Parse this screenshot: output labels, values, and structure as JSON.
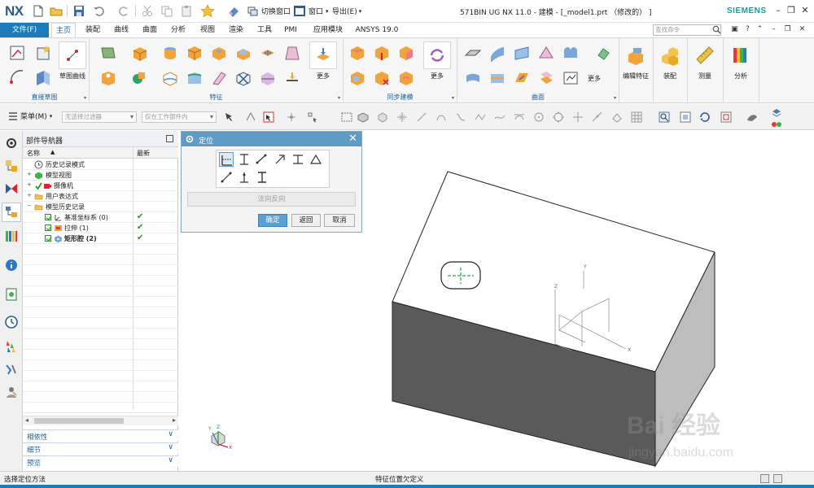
{
  "app": {
    "logo": "NX",
    "window_title": "571BIN UG NX 11.0 - 建模 - [_model1.prt （修改的） ]",
    "vendor": "SIEMENS",
    "switch_window": "切换窗口",
    "window_menu": "窗口",
    "export_menu": "导出(E)",
    "accent_color": "#1c7bb8"
  },
  "ribbon_tabs": {
    "file": "文件(F)",
    "items": [
      "主页",
      "装配",
      "曲线",
      "曲面",
      "分析",
      "视图",
      "渲染",
      "工具",
      "PMI",
      "应用模块",
      "ANSYS 19.0"
    ],
    "active": "主页",
    "search_placeholder": "查找命令"
  },
  "ribbon_groups": {
    "direct_sketch": "直接草图",
    "sketch_curve": "草图曲线",
    "feature": "特征",
    "more_1": "更多",
    "sync_modeling": "同步建模",
    "more_2": "更多",
    "surface": "曲面",
    "more_3": "更多",
    "edit_feature": "编辑特征",
    "assembly": "装配",
    "measure": "测量",
    "analysis": "分析"
  },
  "selection_bar": {
    "menu": "菜单(M)",
    "filter_placeholder": "无选择过滤器",
    "scope_placeholder": "仅在工作部件内"
  },
  "navigator": {
    "title": "部件导航器",
    "col_name": "名称",
    "col_sort": "▲",
    "col_latest": "最新",
    "rows": [
      {
        "label": "历史记录模式",
        "latest": ""
      },
      {
        "label": "模型视图",
        "latest": ""
      },
      {
        "label": "摄像机",
        "latest": ""
      },
      {
        "label": "用户表达式",
        "latest": ""
      },
      {
        "label": "模型历史记录",
        "latest": ""
      },
      {
        "label": "基准坐标系 (0)",
        "latest": "✔"
      },
      {
        "label": "拉伸 (1)",
        "latest": "✔"
      },
      {
        "label": "矩形腔 (2)",
        "latest": "✔"
      }
    ],
    "panels": [
      "相依性",
      "细节",
      "预览"
    ]
  },
  "dialog": {
    "title": "定位",
    "normal_reverse": "法向反向",
    "ok": "确定",
    "back": "返回",
    "cancel": "取消"
  },
  "viewport": {
    "triad_x": "X",
    "triad_y": "Y",
    "triad_z": "Z",
    "csys_x": "X",
    "csys_y": "Y",
    "csys_z": "Z"
  },
  "status": {
    "left": "选择定位方法",
    "center": "特征位置欠定义"
  },
  "watermark": {
    "logo": "Bai 经验",
    "url": "jingyan.baidu.com"
  }
}
